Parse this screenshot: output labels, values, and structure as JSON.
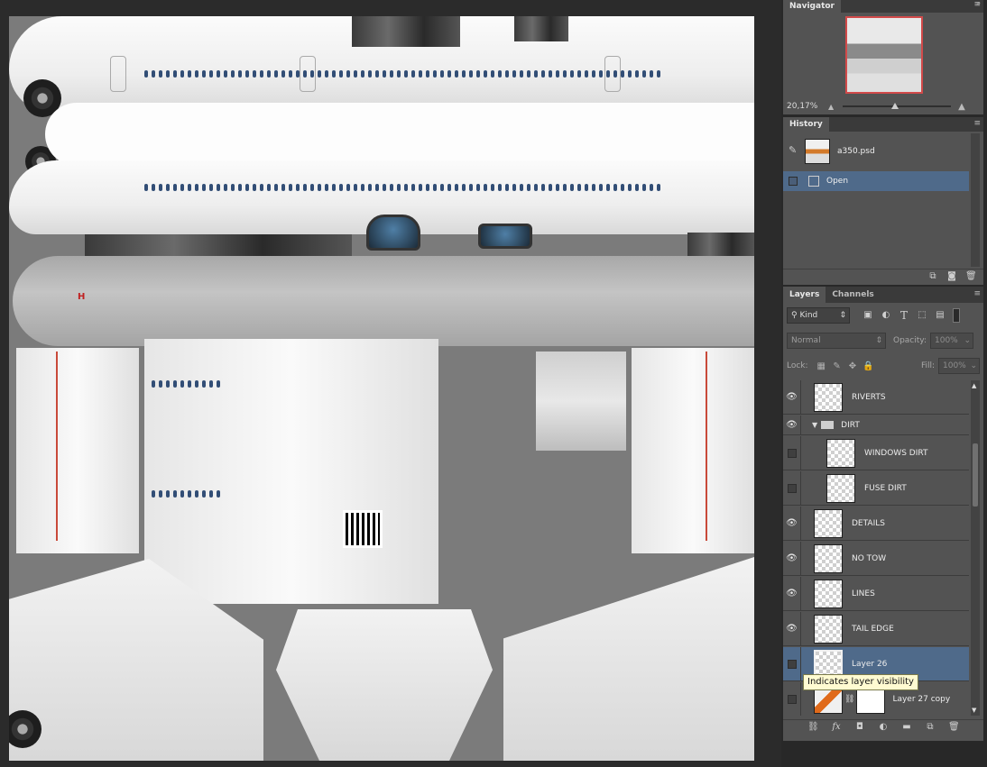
{
  "navigator": {
    "title": "Navigator",
    "zoom": "20,17%"
  },
  "history": {
    "title": "History",
    "snapshot_name": "a350.psd",
    "steps": [
      {
        "label": "Open"
      }
    ]
  },
  "layers_panel": {
    "tabs": [
      {
        "label": "Layers"
      },
      {
        "label": "Channels"
      }
    ],
    "filter_kind": "Kind",
    "blend_mode": "Normal",
    "opacity_label": "Opacity:",
    "opacity_value": "100%",
    "lock_label": "Lock:",
    "fill_label": "Fill:",
    "fill_value": "100%",
    "group": {
      "name": "DIRT"
    },
    "layers": [
      {
        "name": "RIVERTS",
        "visible": true
      },
      {
        "name": "WINDOWS DIRT",
        "visible": false
      },
      {
        "name": "FUSE DIRT",
        "visible": false
      },
      {
        "name": "DETAILS",
        "visible": true
      },
      {
        "name": "NO TOW",
        "visible": true
      },
      {
        "name": "LINES",
        "visible": true
      },
      {
        "name": "TAIL EDGE",
        "visible": true
      },
      {
        "name": "Layer 26",
        "visible": false
      },
      {
        "name": "Layer 27 copy",
        "visible": false
      }
    ]
  },
  "tooltip": "Indicates layer visibility",
  "colors": {
    "panel_bg": "#535353",
    "selection": "#4f6a8a",
    "accent_red": "#d24a4a"
  }
}
